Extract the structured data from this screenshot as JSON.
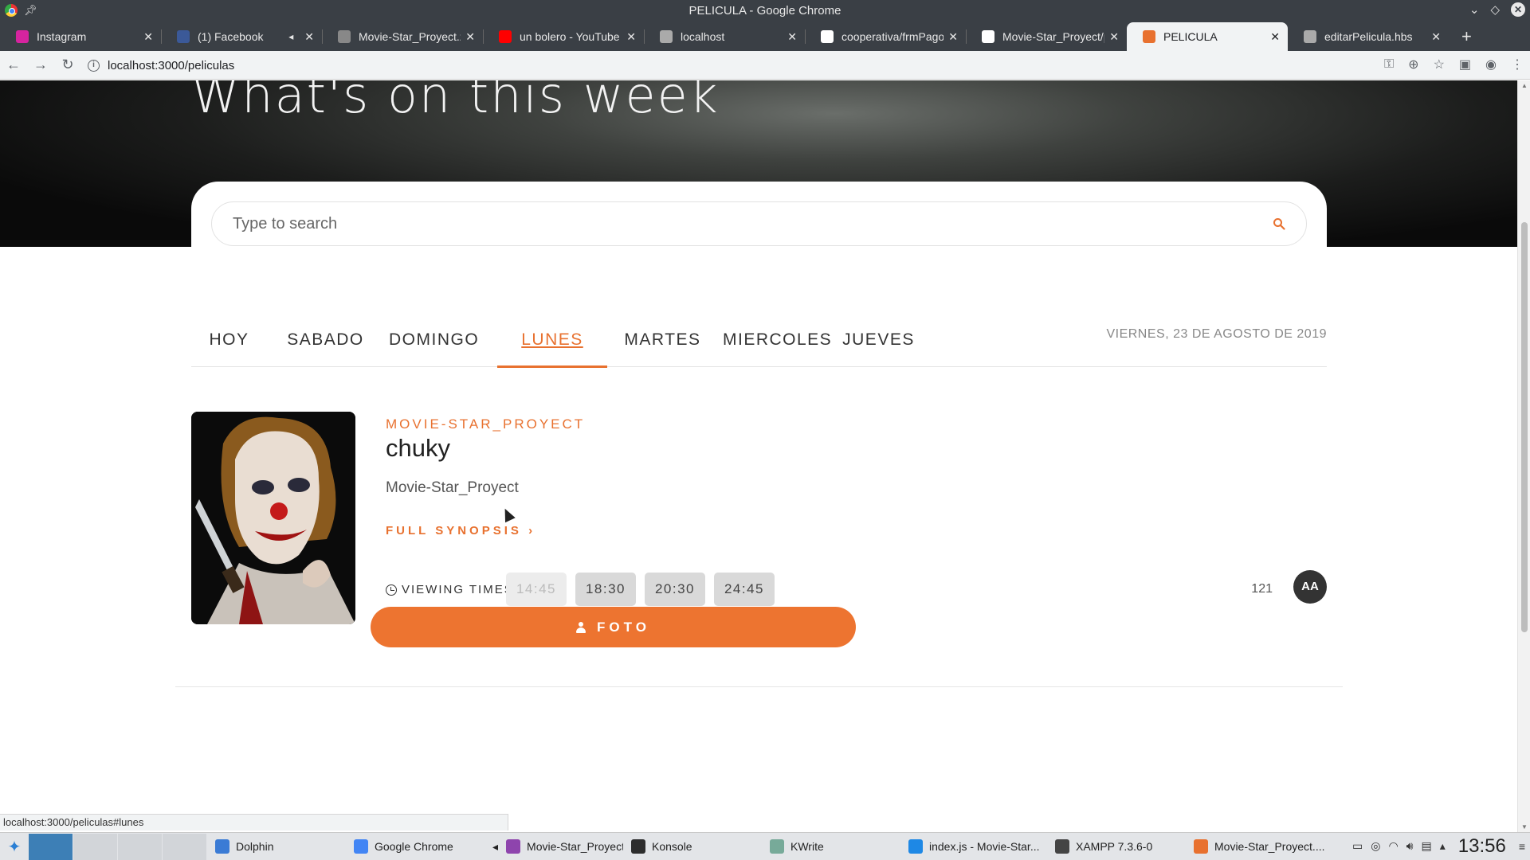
{
  "window": {
    "title": "PELICULA - Google Chrome"
  },
  "tabs": [
    {
      "label": "Instagram",
      "icon": "instagram-icon",
      "color": "#d6249f"
    },
    {
      "label": "(1) Facebook",
      "icon": "facebook-icon",
      "color": "#3b5998",
      "muted": true
    },
    {
      "label": "Movie-Star_Proyect.zip",
      "icon": "file-icon",
      "color": "#888888"
    },
    {
      "label": "un bolero - YouTube",
      "icon": "youtube-icon",
      "color": "#ff0000"
    },
    {
      "label": "localhost",
      "icon": "globe-icon",
      "color": "#aaaaaa"
    },
    {
      "label": "cooperativa/frmPago.h",
      "icon": "github-icon",
      "color": "#ffffff"
    },
    {
      "label": "Movie-Star_Proyect/pe",
      "icon": "github-icon",
      "color": "#ffffff"
    },
    {
      "label": "PELICULA",
      "icon": "page-icon",
      "color": "#e8712f",
      "active": true
    },
    {
      "label": "editarPelicula.hbs",
      "icon": "globe-icon",
      "color": "#aaaaaa"
    }
  ],
  "address": {
    "url": "localhost:3000/peliculas"
  },
  "page": {
    "hero_title": "What's on this week",
    "search_placeholder": "Type to search",
    "days": [
      "HOY",
      "SABADO",
      "DOMINGO",
      "LUNES",
      "MARTES",
      "MIERCOLES",
      "JUEVES"
    ],
    "active_day": "LUNES",
    "current_date": "VIERNES, 23 DE AGOSTO DE 2019",
    "movie": {
      "brand": "MOVIE-STAR_PROYECT",
      "title": "chuky",
      "subtitle": "Movie-Star_Proyect",
      "synopsis_link": "FULL SYNOPSIS",
      "viewing_times_label": "VIEWING TIMES",
      "times": [
        {
          "time": "14:45",
          "past": true
        },
        {
          "time": "18:30",
          "past": false
        },
        {
          "time": "20:30",
          "past": false
        },
        {
          "time": "24:45",
          "past": false
        }
      ],
      "duration": "121",
      "rating": "AA",
      "photo_button": "FOTO"
    }
  },
  "status_url": "localhost:3000/peliculas#lunes",
  "taskbar": {
    "tasks": [
      {
        "label": "Dolphin",
        "icon": "dolphin-icon",
        "color": "#3a7bd5"
      },
      {
        "label": "Google Chrome",
        "icon": "chrome-icon",
        "color": "#4285f4"
      },
      {
        "label": "Movie-Star_Proyect -...",
        "icon": "app-icon",
        "color": "#8e44ad",
        "sound": true
      },
      {
        "label": "Konsole",
        "icon": "terminal-icon",
        "color": "#2d2d2d"
      },
      {
        "label": "KWrite",
        "icon": "text-editor-icon",
        "color": "#7a9"
      },
      {
        "label": "index.js - Movie-Star...",
        "icon": "vscode-icon",
        "color": "#1e88e5"
      },
      {
        "label": "XAMPP 7.3.6-0",
        "icon": "xampp-icon",
        "color": "#444444"
      },
      {
        "label": "Movie-Star_Proyect....",
        "icon": "app-icon",
        "color": "#e8712f"
      }
    ],
    "clock": "13:56"
  },
  "colors": {
    "accent": "#e8712f",
    "chrome_dark": "#3a3f45"
  }
}
